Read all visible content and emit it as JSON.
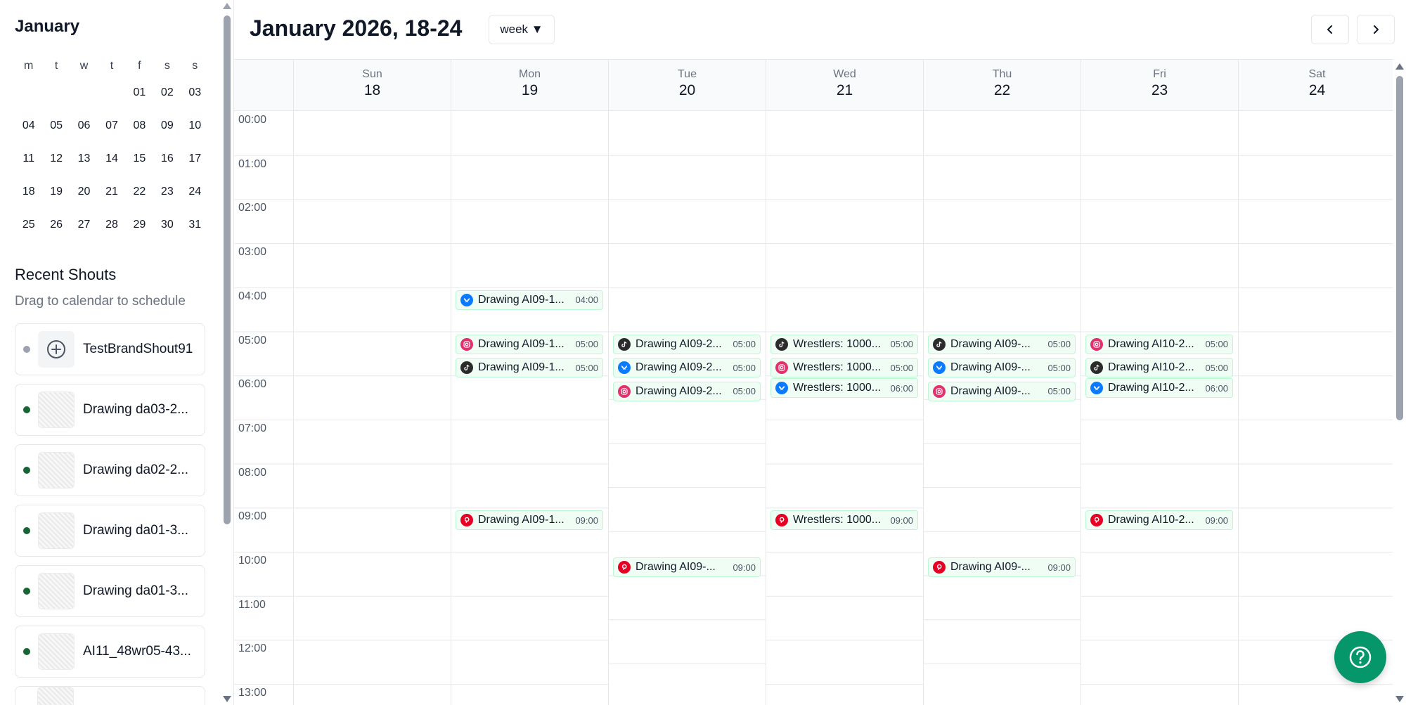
{
  "sidebar": {
    "month_title": "January",
    "weekdays": [
      "m",
      "t",
      "w",
      "t",
      "f",
      "s",
      "s"
    ],
    "weeks": [
      [
        "",
        "",
        "",
        "",
        "01",
        "02",
        "03"
      ],
      [
        "04",
        "05",
        "06",
        "07",
        "08",
        "09",
        "10"
      ],
      [
        "11",
        "12",
        "13",
        "14",
        "15",
        "16",
        "17"
      ],
      [
        "18",
        "19",
        "20",
        "21",
        "22",
        "23",
        "24"
      ],
      [
        "25",
        "26",
        "27",
        "28",
        "29",
        "30",
        "31"
      ]
    ],
    "recent_title": "Recent Shouts",
    "recent_subtitle": "Drag to calendar to schedule",
    "shouts": [
      {
        "name": "TestBrandShout91",
        "status_color": "#9ca3af",
        "thumb": "add-circle-icon"
      },
      {
        "name": "Drawing da03-2...",
        "status_color": "#166534",
        "thumb": "image"
      },
      {
        "name": "Drawing da02-2...",
        "status_color": "#166534",
        "thumb": "image"
      },
      {
        "name": "Drawing da01-3...",
        "status_color": "#166534",
        "thumb": "image"
      },
      {
        "name": "Drawing da01-3...",
        "status_color": "#166534",
        "thumb": "image"
      },
      {
        "name": "AI11_48wr05-43...",
        "status_color": "#166534",
        "thumb": "image"
      }
    ]
  },
  "header": {
    "title": "January 2026, 18-24",
    "view_label": "week ▼",
    "prev_icon": "chevron-left-icon",
    "next_icon": "chevron-right-icon"
  },
  "days": [
    {
      "name": "Sun",
      "date": "18"
    },
    {
      "name": "Mon",
      "date": "19"
    },
    {
      "name": "Tue",
      "date": "20"
    },
    {
      "name": "Wed",
      "date": "21"
    },
    {
      "name": "Thu",
      "date": "22"
    },
    {
      "name": "Fri",
      "date": "23"
    },
    {
      "name": "Sat",
      "date": "24"
    }
  ],
  "hours": [
    "00:00",
    "01:00",
    "02:00",
    "03:00",
    "04:00",
    "05:00",
    "06:00",
    "07:00",
    "08:00",
    "09:00",
    "10:00",
    "11:00",
    "12:00",
    "13:00"
  ],
  "platform_colors": {
    "bluesky": "#0a7aff",
    "instagram": "#e1306c",
    "tiktok": "#2b2b2b",
    "pinterest": "#e60023"
  },
  "events": [
    {
      "day": 1,
      "hour": 4,
      "slot": 0,
      "title": "Drawing AI09-1...",
      "time": "04:00",
      "platform": "bluesky"
    },
    {
      "day": 1,
      "hour": 5,
      "slot": 0,
      "title": "Drawing AI09-1...",
      "time": "05:00",
      "platform": "instagram"
    },
    {
      "day": 1,
      "hour": 5,
      "slot": 1,
      "title": "Drawing AI09-1...",
      "time": "05:00",
      "platform": "tiktok"
    },
    {
      "day": 1,
      "hour": 9,
      "slot": 0,
      "title": "Drawing AI09-1...",
      "time": "09:00",
      "platform": "pinterest"
    },
    {
      "day": 2,
      "hour": 5,
      "slot": 0,
      "title": "Drawing AI09-2...",
      "time": "05:00",
      "platform": "tiktok"
    },
    {
      "day": 2,
      "hour": 5,
      "slot": 1,
      "title": "Drawing AI09-2...",
      "time": "05:00",
      "platform": "bluesky"
    },
    {
      "day": 2,
      "hour": 5,
      "slot": 2,
      "title": "Drawing AI09-2...",
      "time": "05:00",
      "platform": "instagram"
    },
    {
      "day": 2,
      "hour": 9,
      "slot": 1,
      "title": "Drawing AI09-...",
      "time": "09:00",
      "platform": "pinterest"
    },
    {
      "day": 3,
      "hour": 5,
      "slot": 0,
      "title": "Wrestlers: 1000...",
      "time": "05:00",
      "platform": "tiktok"
    },
    {
      "day": 3,
      "hour": 5,
      "slot": 1,
      "title": "Wrestlers: 1000...",
      "time": "05:00",
      "platform": "instagram"
    },
    {
      "day": 3,
      "hour": 6,
      "slot": 0,
      "title": "Wrestlers: 1000...",
      "time": "06:00",
      "platform": "bluesky"
    },
    {
      "day": 3,
      "hour": 9,
      "slot": 0,
      "title": "Wrestlers: 1000...",
      "time": "09:00",
      "platform": "pinterest"
    },
    {
      "day": 4,
      "hour": 5,
      "slot": 0,
      "title": "Drawing AI09-...",
      "time": "05:00",
      "platform": "tiktok"
    },
    {
      "day": 4,
      "hour": 5,
      "slot": 1,
      "title": "Drawing AI09-...",
      "time": "05:00",
      "platform": "bluesky"
    },
    {
      "day": 4,
      "hour": 5,
      "slot": 2,
      "title": "Drawing AI09-...",
      "time": "05:00",
      "platform": "instagram"
    },
    {
      "day": 4,
      "hour": 9,
      "slot": 1,
      "title": "Drawing AI09-...",
      "time": "09:00",
      "platform": "pinterest"
    },
    {
      "day": 5,
      "hour": 5,
      "slot": 0,
      "title": "Drawing AI10-2...",
      "time": "05:00",
      "platform": "instagram"
    },
    {
      "day": 5,
      "hour": 5,
      "slot": 1,
      "title": "Drawing AI10-2...",
      "time": "05:00",
      "platform": "tiktok"
    },
    {
      "day": 5,
      "hour": 6,
      "slot": 0,
      "title": "Drawing AI10-2...",
      "time": "06:00",
      "platform": "bluesky"
    },
    {
      "day": 5,
      "hour": 9,
      "slot": 0,
      "title": "Drawing AI10-2...",
      "time": "09:00",
      "platform": "pinterest"
    }
  ],
  "help_icon": "help-question-icon"
}
